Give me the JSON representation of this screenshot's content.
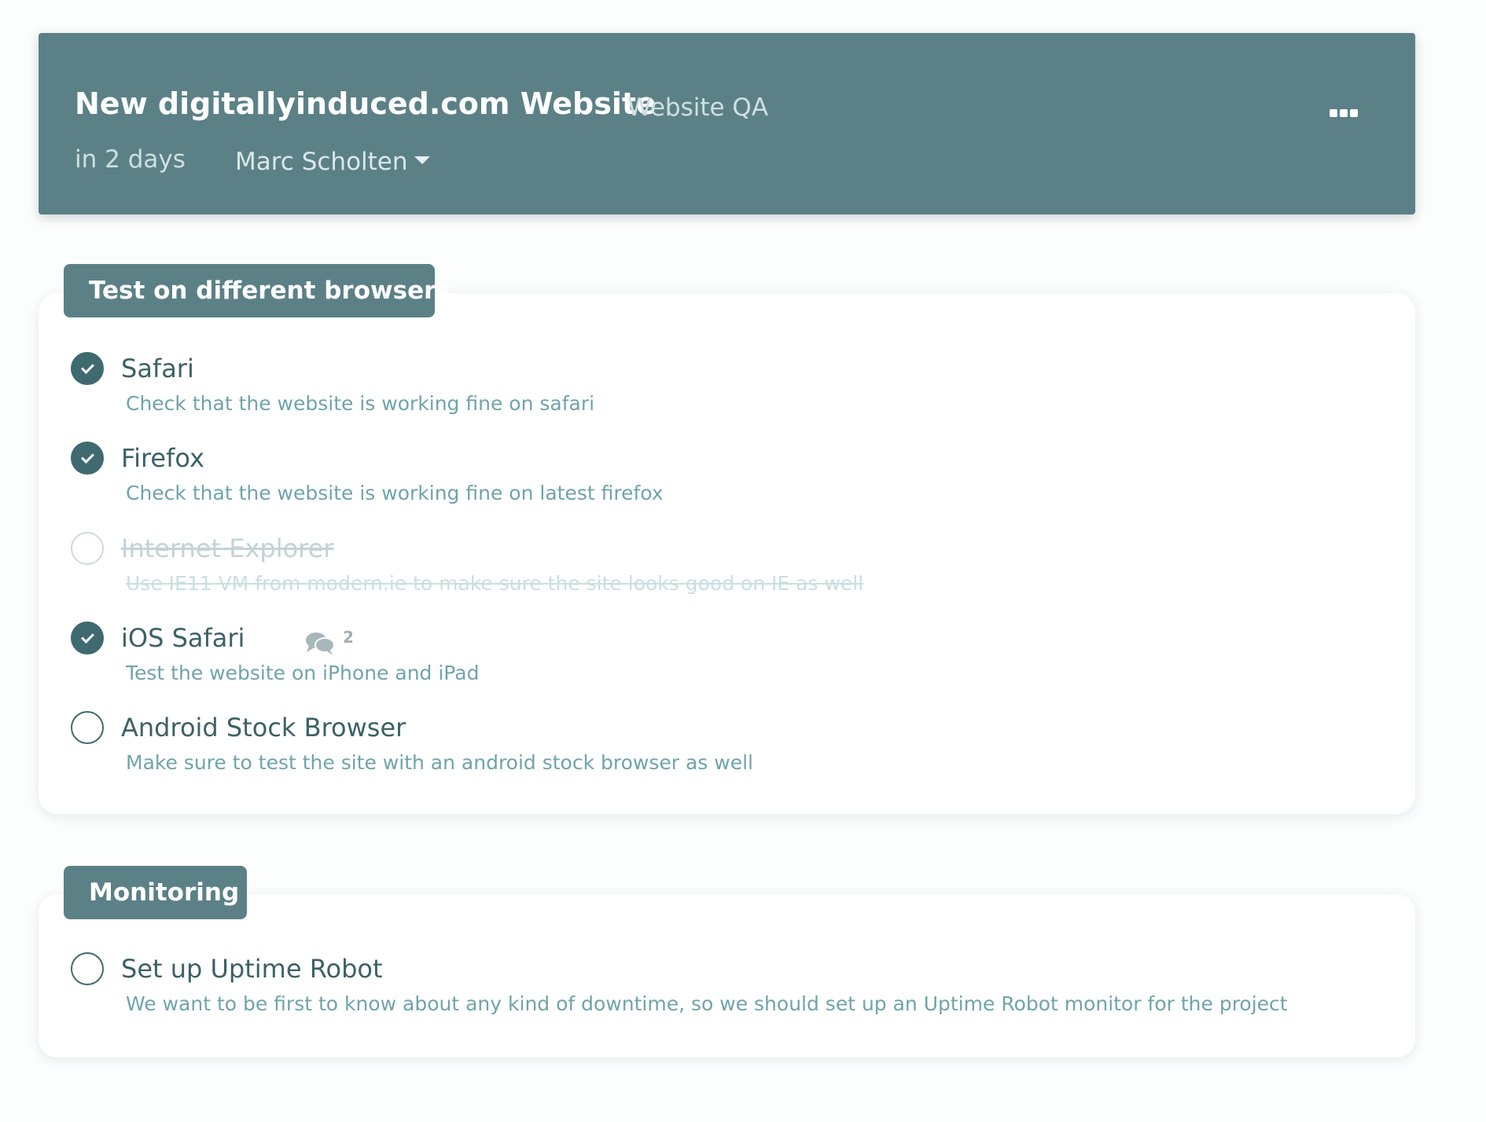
{
  "header": {
    "title": "New digitallyinduced.com Website",
    "subtitle": "Website QA",
    "due": "in 2 days",
    "assignee": "Marc Scholten",
    "more_icon": "ellipsis-icon"
  },
  "sections": [
    {
      "title": "Test on different browsers",
      "tasks": [
        {
          "name": "Safari",
          "description": "Check that the website is working fine on safari",
          "status": "done"
        },
        {
          "name": "Firefox",
          "description": "Check that the website is working fine on latest firefox",
          "status": "done"
        },
        {
          "name": "Internet Explorer",
          "description": "Use IE11 VM from modern.ie to make sure the site looks good on IE as well",
          "status": "cancelled"
        },
        {
          "name": "iOS Safari",
          "description": "Test the website on iPhone and iPad",
          "status": "done",
          "comments": "2",
          "comments_icon": "comments-icon"
        },
        {
          "name": "Android Stock Browser",
          "description": "Make sure to test the site with an android stock browser as well",
          "status": "open"
        }
      ]
    },
    {
      "title": "Monitoring",
      "tasks": [
        {
          "name": "Set up Uptime Robot",
          "description": "We want to be first to know about any kind of downtime, so we should set up an Uptime Robot monitor for the project",
          "status": "open"
        }
      ]
    }
  ],
  "colors": {
    "header_bg": "#5b8187",
    "checkbox_done": "#3f6a70",
    "description_text": "#6fa4ab"
  }
}
